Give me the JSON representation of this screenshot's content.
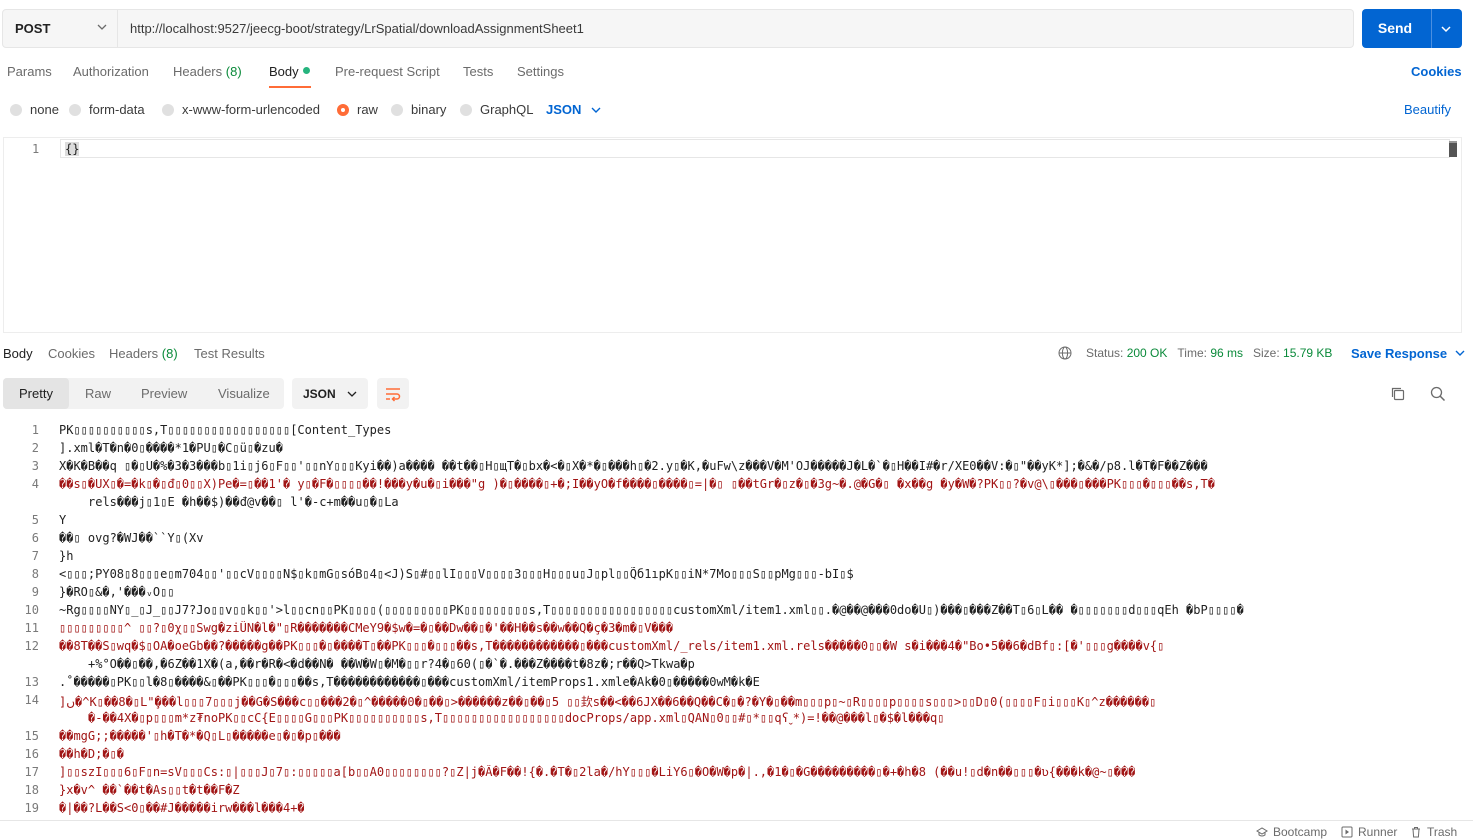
{
  "request": {
    "method": "POST",
    "url": "http://localhost:9527/jeecg-boot/strategy/LrSpatial/downloadAssignmentSheet1",
    "send_label": "Send"
  },
  "req_tabs": {
    "params": "Params",
    "authorization": "Authorization",
    "headers": "Headers",
    "headers_count": "(8)",
    "body": "Body",
    "prerequest": "Pre-request Script",
    "tests": "Tests",
    "settings": "Settings",
    "cookies": "Cookies"
  },
  "body_types": {
    "none": "none",
    "form_data": "form-data",
    "urlencoded": "x-www-form-urlencoded",
    "raw": "raw",
    "binary": "binary",
    "graphql": "GraphQL",
    "language": "JSON",
    "beautify": "Beautify"
  },
  "editor": {
    "line1_num": "1",
    "line1_code": "{}"
  },
  "resp_tabs": {
    "body": "Body",
    "cookies": "Cookies",
    "headers": "Headers",
    "headers_count": "(8)",
    "test_results": "Test Results"
  },
  "status": {
    "status_label": "Status:",
    "status_value": "200 OK",
    "time_label": "Time:",
    "time_value": "96 ms",
    "size_label": "Size:",
    "size_value": "15.79 KB",
    "save_label": "Save Response"
  },
  "resp_view": {
    "pretty": "Pretty",
    "raw": "Raw",
    "preview": "Preview",
    "visualize": "Visualize",
    "format": "JSON"
  },
  "response_lines": [
    {
      "n": "1",
      "t": "PK▯▯▯▯▯▯▯▯▯▯s,T▯▯▯▯▯▯▯▯▯▯▯▯▯▯▯▯▯[Content_Types"
    },
    {
      "n": "2",
      "t": "].xml�T�n�0▯����*1�PU▯�C▯ü▯�zu�"
    },
    {
      "n": "3",
      "t": "X�K�B��q ▯�▯U�%�3�3���b▯1i▯j6▯F▯▯'▯▯nY▯▯▯Kyi��)a����  ��t��▯H▯щT�▯bx�<�▯X�*�▯���h▯�2.y▯�K,�uFw\\z���V�M'OJ�����J�L�`�▯H��I#�r/XE0��V:�▯\"��yK*];�&�/p8.l�T�F��Z���"
    },
    {
      "n": "4",
      "t": "��s▯�UX▯�=�k▯�▯đ▯0▯▯X)Pe�=▯��1'� y▯�F�▯▯▯▯��!���y�u�▯i���\"g  )�▯����▯+�;I��yO�f����▯����▯=|�▯  ▯��tGr�▯z�▯�3g~�.@�G�▯ �x��g �y�W�?PK▯▯?�v@\\▯���▯���PK▯▯▯�▯▯▯��s,T�",
      "t2": "rels���j▯1▯E �h��$)��đ@v��▯ l'�-c+m��u▯�▯La"
    },
    {
      "n": "5",
      "t": "Y"
    },
    {
      "n": "6",
      "t": "��▯ ovg?�WJ��``Y▯(Xv"
    },
    {
      "n": "7",
      "t": "}h"
    },
    {
      "n": "8",
      "t": "<▯▯▯;PY08▯8▯▯▯e▯m704▯▯'▯▯cV▯▯▯▯N$▯k▯mG▯sóB▯4▯<J)S▯#▯▯lΙ▯▯▯V▯▯▯▯3▯▯▯H▯▯▯u▯Ј▯pl▯▯Q̃б1ıpK▯▯iN*7Mo▯▯▯S▯▯pMg▯▯▯-bI▯$"
    },
    {
      "n": "9",
      "t": "}�RO▯&�,'���ᵥO▯▯"
    },
    {
      "n": "10",
      "t": "~Rg▯▯▯▯NY▯_▯J_▯▯J7?Jo▯▯v▯▯k▯▯'>l▯▯cn▯▯PK▯▯▯▯(▯▯▯▯▯▯▯▯▯PK▯▯▯▯▯▯▯▯▯s,T▯▯▯▯▯▯▯▯▯▯▯▯▯▯▯▯▯customXml/item1.xml▯▯.�@��@���0do�U▯)���▯���Z��T▯6▯L��  �▯▯▯▯▯▯▯d▯▯▯qEh �bP▯▯▯▯�"
    },
    {
      "n": "11",
      "t": "▯▯▯▯▯▯▯▯▯^  ▯▯?▯0χ▯▯Swg�ziÜN�l�\"▯R�������CMeY9�$w�=�▯��Dw��▯�'��H��s��w��Q�ç�3�m�▯V���"
    },
    {
      "n": "12",
      "t": "��8T��S▯wq�$▯OA�oeGb��?�����g��PK▯▯▯�▯����T▯��PK▯▯▯�▯▯▯��s,T������������▯���customXml/_rels/item1.xml.rels�����0▯▯�W   s�i���4�\"Bo•5��6�dBf▯:[�'▯▯▯g����v{▯",
      "t2": "+%°O��▯��,�6Z��1X�(a,��r�R�<�d��N� ��W�W▯�M�▯▯r?4�▯60(▯�`�.���Z����t�8z�;r��Q>Tkwa�p"
    },
    {
      "n": "13",
      "t": ".˚�����▯PK▯▯l�8▯����&▯��PK▯▯▯�▯▯▯��s,T������������▯���customXml/itemProps1.xmle�Ak�0▯�����0wM�k�E"
    },
    {
      "n": "14",
      "t": "]ں�^K▯��8�▯L\"̧���l▯▯▯7▯▯▯j��G�S���c▯▯���2�▯^�����0�▯��▯>������z��▯��▯5   ▯▯㰪s��<��6JX��6��Q��C�▯�?�Y�▯��m▯▯▯p▯~▯R▯▯▯▯p▯▯▯▯s▯▯▯>▯▯D▯0(▯▯▯▯F▯i▯▯▯K▯^z������▯",
      "t2": "�-��4X�▯p▯▯▯m*z₮ոoPK▯▯cC{E▯▯▯▯G▯▯▯PK▯▯▯▯▯▯▯▯▯▯s,T▯▯▯▯▯▯▯▯▯▯▯▯▯▯▯▯▯docProps/app.xml▯QAN▯0▯▯#▯*▯▯qʕˬ*)=!��@���l▯�$�l���q▯"
    },
    {
      "n": "15",
      "t": "��mgG;;�����'▯h�T�*�Q▯L▯�����e▯�▯�p▯���"
    },
    {
      "n": "16",
      "t": "��h�D;�▯�"
    },
    {
      "n": "17",
      "t": "]▯▯szI▯▯▯6▯F▯n=sV▯▯▯Cs:▯|▯▯▯J▯7▯:▯▯▯▯▯a[b▯▯A0▯▯▯▯▯▯▯▯?▯Z|j�Â�F��!{�.�T�▯2la�/hY▯▯▯�LiY6▯�O�W�p�|.,�1�▯�G���������▯�+�h�8 (��u!▯d�n��▯▯▯�ʋ{���k�@~▯���"
    },
    {
      "n": "18",
      "t": "}x�v^ ��`��t�As▯▯t�t��F�Z"
    },
    {
      "n": "19",
      "t": "�|��?L��S<0▯��#J�����irw���l���4+�"
    }
  ],
  "footer": {
    "bootcamp": "Bootcamp",
    "runner": "Runner",
    "trash": "Trash"
  },
  "colors": {
    "accent": "#ff6c37",
    "primary": "#0265d2",
    "success": "#0a8a3a",
    "error_text": "#a11515"
  },
  "icons": {
    "method_dropdown": "chevron-down-icon",
    "send_dropdown": "chevron-down-icon",
    "globe": "globe-icon",
    "copy": "copy-icon",
    "search": "search-icon",
    "wrap": "wrap-lines-icon"
  }
}
